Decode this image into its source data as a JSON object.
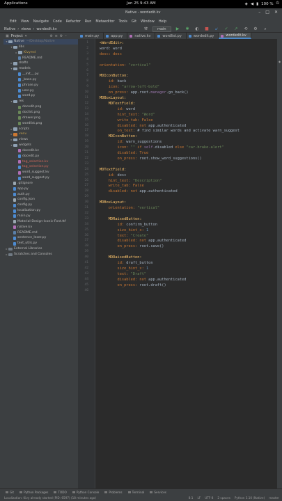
{
  "gnome": {
    "activities": "Applications",
    "clock": "Jan 25  9:43 AM",
    "battery": "100 %"
  },
  "window": {
    "title": "Native - wordedit.kv"
  },
  "menu": [
    "Edit",
    "View",
    "Navigate",
    "Code",
    "Refactor",
    "Run",
    "Metaeditor",
    "Tools",
    "Git",
    "Window",
    "Help"
  ],
  "breadcrumb": [
    "Native",
    "views",
    "wordedit.kv"
  ],
  "toolbar": {
    "run_config": "main"
  },
  "project_header": "Project",
  "tabs": [
    {
      "label": "main.py",
      "kind": "py"
    },
    {
      "label": "app.py",
      "kind": "py"
    },
    {
      "label": "native.kv",
      "kind": "kv"
    },
    {
      "label": "wordlist.py",
      "kind": "py"
    },
    {
      "label": "wordedit.py",
      "kind": "py"
    },
    {
      "label": "wordedit.kv",
      "kind": "kv",
      "active": true
    }
  ],
  "tree": [
    {
      "label": "Native",
      "hint": "~/Desktop/Native",
      "indent": 0,
      "icon": "folder",
      "arrow": "▾",
      "selected": true
    },
    {
      "label": "libs",
      "indent": 1,
      "icon": "folder",
      "arrow": "▾"
    },
    {
      "label": "Kivymd",
      "indent": 2,
      "icon": "folder",
      "arrow": "▸",
      "color": "orange"
    },
    {
      "label": "README.md",
      "indent": 2,
      "icon": "mdf",
      "arrow": ""
    },
    {
      "label": "drafts",
      "indent": 1,
      "icon": "folder",
      "arrow": "▸"
    },
    {
      "label": "models",
      "indent": 1,
      "icon": "folder",
      "arrow": "▾"
    },
    {
      "label": "__init__.py",
      "indent": 2,
      "icon": "pyf",
      "arrow": ""
    },
    {
      "label": "_base.py",
      "indent": 2,
      "icon": "pyf",
      "arrow": ""
    },
    {
      "label": "phrase.py",
      "indent": 2,
      "icon": "pyf",
      "arrow": ""
    },
    {
      "label": "user.py",
      "indent": 2,
      "icon": "pyf",
      "arrow": ""
    },
    {
      "label": "word.py",
      "indent": 2,
      "icon": "pyf",
      "arrow": ""
    },
    {
      "label": "res",
      "indent": 1,
      "icon": "folder",
      "arrow": "▾"
    },
    {
      "label": "docedit.png",
      "indent": 2,
      "icon": "img",
      "arrow": ""
    },
    {
      "label": "doclist.png",
      "indent": 2,
      "icon": "img",
      "arrow": ""
    },
    {
      "label": "drawer.png",
      "indent": 2,
      "icon": "img",
      "arrow": ""
    },
    {
      "label": "wordlist.png",
      "indent": 2,
      "icon": "img",
      "arrow": ""
    },
    {
      "label": "scripts",
      "indent": 1,
      "icon": "folder",
      "arrow": "▸"
    },
    {
      "label": "venv",
      "indent": 1,
      "icon": "folder excl",
      "arrow": "▸",
      "color": "orange"
    },
    {
      "label": "views",
      "indent": 1,
      "icon": "folder",
      "arrow": "▸"
    },
    {
      "label": "widgets",
      "indent": 1,
      "icon": "folder",
      "arrow": "▾"
    },
    {
      "label": "docedit.kv",
      "indent": 2,
      "icon": "kvf",
      "arrow": ""
    },
    {
      "label": "docedit.py",
      "indent": 2,
      "icon": "pyf",
      "arrow": ""
    },
    {
      "label": "tag_selection.kv",
      "indent": 2,
      "icon": "kvf",
      "arrow": "",
      "color": "red"
    },
    {
      "label": "tag_selection.py",
      "indent": 2,
      "icon": "pyf",
      "arrow": "",
      "color": "red"
    },
    {
      "label": "word_suggest.kv",
      "indent": 2,
      "icon": "kvf",
      "arrow": ""
    },
    {
      "label": "word_suggest.py",
      "indent": 2,
      "icon": "pyf",
      "arrow": ""
    },
    {
      "label": ".gitignore",
      "indent": 1,
      "icon": "file",
      "arrow": ""
    },
    {
      "label": "app.py",
      "indent": 1,
      "icon": "pyf",
      "arrow": ""
    },
    {
      "label": "auth.py",
      "indent": 1,
      "icon": "pyf",
      "arrow": ""
    },
    {
      "label": "config.json",
      "indent": 1,
      "icon": "file",
      "arrow": ""
    },
    {
      "label": "config.py",
      "indent": 1,
      "icon": "pyf",
      "arrow": ""
    },
    {
      "label": "localization.py",
      "indent": 1,
      "icon": "pyf",
      "arrow": ""
    },
    {
      "label": "main.py",
      "indent": 1,
      "icon": "pyf",
      "arrow": ""
    },
    {
      "label": "Material-Design-Iconic-Font.ttf",
      "indent": 1,
      "icon": "file",
      "arrow": ""
    },
    {
      "label": "native.kv",
      "indent": 1,
      "icon": "kvf",
      "arrow": ""
    },
    {
      "label": "README.md",
      "indent": 1,
      "icon": "mdf",
      "arrow": ""
    },
    {
      "label": "sentence_lexer.py",
      "indent": 1,
      "icon": "pyf",
      "arrow": ""
    },
    {
      "label": "text_utils.py",
      "indent": 1,
      "icon": "pyf",
      "arrow": ""
    },
    {
      "label": "External Libraries",
      "indent": 0,
      "icon": "lib",
      "arrow": "▸"
    },
    {
      "label": "Scratches and Consoles",
      "indent": 0,
      "icon": "lib",
      "arrow": "▸"
    }
  ],
  "code": [
    [
      [
        "<WordEdit>:",
        "k-cls"
      ]
    ],
    [
      [
        "word: word",
        "k-plain"
      ]
    ],
    [
      [
        "desc: desc",
        "k-prop"
      ]
    ],
    [],
    [
      [
        "orientation: ",
        "k-prop"
      ],
      [
        "\"vertical\"",
        "k-str"
      ]
    ],
    [],
    [
      [
        "MDIconButton:",
        "k-cls"
      ]
    ],
    [
      [
        "    id: ",
        "k-prop"
      ],
      [
        "back",
        "k-plain"
      ]
    ],
    [
      [
        "    icon: ",
        "k-prop"
      ],
      [
        "\"arrow-left-bold\"",
        "k-str"
      ]
    ],
    [
      [
        "    on_press: ",
        "k-prop"
      ],
      [
        "app.root.",
        "k-plain"
      ],
      [
        "manager",
        "k-var"
      ],
      [
        ".go_back()",
        "k-plain"
      ]
    ],
    [
      [
        "MDBoxLayout:",
        "k-cls"
      ]
    ],
    [
      [
        "    MDTextField:",
        "k-cls"
      ]
    ],
    [
      [
        "        id: ",
        "k-prop"
      ],
      [
        "word",
        "k-plain"
      ]
    ],
    [
      [
        "        hint_text: ",
        "k-prop"
      ],
      [
        "\"Word\"",
        "k-str"
      ]
    ],
    [
      [
        "        write_tab: ",
        "k-prop"
      ],
      [
        "False",
        "k-kw"
      ]
    ],
    [
      [
        "        disabled: ",
        "k-prop"
      ],
      [
        "not ",
        "k-kw"
      ],
      [
        "app.authenticated",
        "k-plain"
      ]
    ],
    [
      [
        "        on_text: ",
        "k-prop"
      ],
      [
        "# find similar words and activate warn_suggest",
        "k-plain"
      ]
    ],
    [
      [
        "    MDIconButton:",
        "k-cls"
      ]
    ],
    [
      [
        "        id: ",
        "k-prop"
      ],
      [
        "warn_suggestions",
        "k-plain"
      ]
    ],
    [
      [
        "        icon: ",
        "k-prop"
      ],
      [
        "\"\" ",
        "k-str"
      ],
      [
        "if ",
        "k-kw"
      ],
      [
        "self",
        "k-var"
      ],
      [
        ".disabled ",
        "k-plain"
      ],
      [
        "else ",
        "k-kw"
      ],
      [
        "\"car-brake-alert\"",
        "k-str"
      ]
    ],
    [
      [
        "        disabled: ",
        "k-prop"
      ],
      [
        "True",
        "k-kw"
      ]
    ],
    [
      [
        "        on_press: ",
        "k-prop"
      ],
      [
        "root.show_word_suggestions()",
        "k-plain"
      ]
    ],
    [],
    [
      [
        "MDTextField:",
        "k-cls"
      ]
    ],
    [
      [
        "    id: ",
        "k-prop"
      ],
      [
        "desc",
        "k-plain"
      ]
    ],
    [
      [
        "    hint_text: ",
        "k-prop"
      ],
      [
        "\"Description\"",
        "k-str"
      ]
    ],
    [
      [
        "    write_tab: ",
        "k-prop"
      ],
      [
        "False",
        "k-kw"
      ]
    ],
    [
      [
        "    disabled: ",
        "k-prop"
      ],
      [
        "not ",
        "k-kw"
      ],
      [
        "app.authenticated",
        "k-plain"
      ]
    ],
    [],
    [
      [
        "MDBoxLayout:",
        "k-cls"
      ]
    ],
    [
      [
        "    orientation: ",
        "k-prop"
      ],
      [
        "\"vertical\"",
        "k-str"
      ]
    ],
    [],
    [
      [
        "    MDRaisedButton:",
        "k-cls"
      ]
    ],
    [
      [
        "        id: ",
        "k-prop"
      ],
      [
        "confirm_button",
        "k-plain"
      ]
    ],
    [
      [
        "        size_hint_x: ",
        "k-prop"
      ],
      [
        "1",
        "k-num"
      ]
    ],
    [
      [
        "        text: ",
        "k-prop"
      ],
      [
        "\"Create\"",
        "k-str"
      ]
    ],
    [
      [
        "        disabled: ",
        "k-prop"
      ],
      [
        "not ",
        "k-kw"
      ],
      [
        "app.authenticated",
        "k-plain"
      ]
    ],
    [
      [
        "        on_press: ",
        "k-prop"
      ],
      [
        "root.save()",
        "k-plain"
      ]
    ],
    [],
    [
      [
        "    MDRaisedButton:",
        "k-cls"
      ]
    ],
    [
      [
        "        id: ",
        "k-prop"
      ],
      [
        "draft_button",
        "k-plain"
      ]
    ],
    [
      [
        "        size_hint_x: ",
        "k-prop"
      ],
      [
        "1",
        "k-num"
      ]
    ],
    [
      [
        "        text: ",
        "k-prop"
      ],
      [
        "\"Draft\"",
        "k-str"
      ]
    ],
    [
      [
        "        disabled: ",
        "k-prop"
      ],
      [
        "not ",
        "k-kw"
      ],
      [
        "app.authenticated",
        "k-plain"
      ]
    ],
    [
      [
        "        on_press: ",
        "k-prop"
      ],
      [
        "root.draft()",
        "k-plain"
      ]
    ],
    []
  ],
  "bottom_tabs": [
    "Git",
    "Python Packages",
    "TODO",
    "Python Console",
    "Problems",
    "Terminal",
    "Services"
  ],
  "status": {
    "message": "Localization: Kivy already started (PID: 6597) (18 minutes ago)",
    "items": [
      "8:1",
      "LF",
      "UTF-8",
      "2 spaces",
      "Python 3.10 (Native)",
      "master"
    ]
  }
}
